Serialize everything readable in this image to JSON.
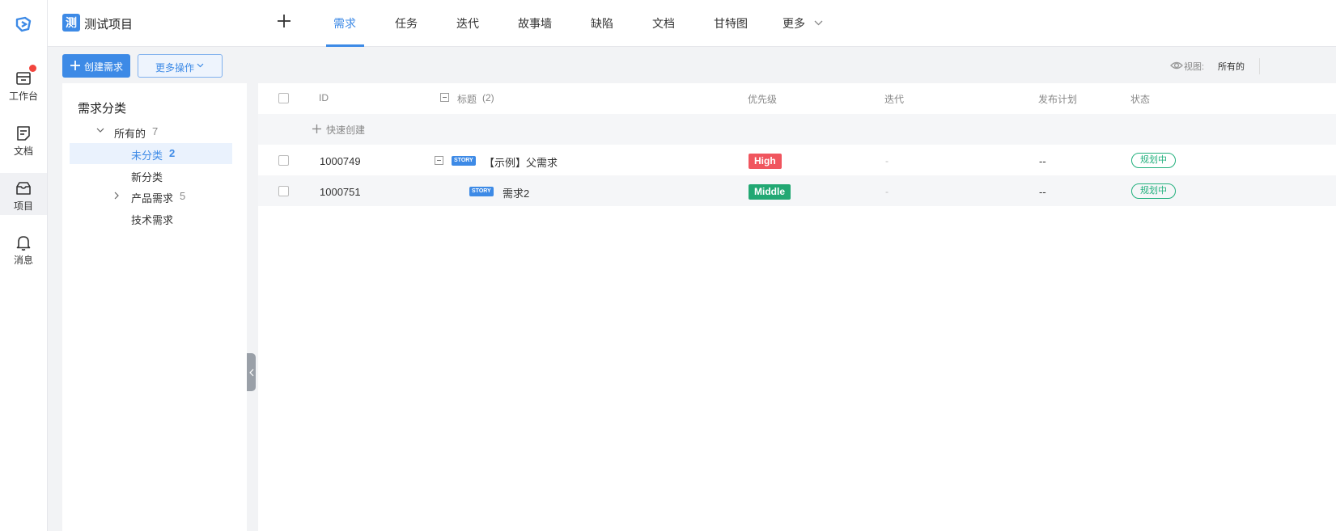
{
  "rail": {
    "items": [
      {
        "label": "工作台"
      },
      {
        "label": "文档"
      },
      {
        "label": "项目"
      },
      {
        "label": "消息"
      }
    ]
  },
  "project": {
    "badge": "测",
    "name": "测试项目"
  },
  "nav": {
    "tabs": [
      "需求",
      "任务",
      "迭代",
      "故事墙",
      "缺陷",
      "文档",
      "甘特图",
      "更多"
    ]
  },
  "toolbar": {
    "create_label": "创建需求",
    "more_label": "更多操作",
    "view_label": "视图:",
    "view_value": "所有的"
  },
  "categories": {
    "title": "需求分类",
    "items": [
      {
        "name": "所有的",
        "count": "7"
      },
      {
        "name": "未分类",
        "count": "2"
      },
      {
        "name": "新分类",
        "count": ""
      },
      {
        "name": "产品需求",
        "count": "5"
      },
      {
        "name": "技术需求",
        "count": ""
      }
    ]
  },
  "table": {
    "headers": {
      "id": "ID",
      "title": "标题",
      "title_count": "(2)",
      "priority": "优先级",
      "iteration": "迭代",
      "release": "发布计划",
      "status": "状态"
    },
    "quick_create": "快速创建",
    "rows": [
      {
        "id": "1000749",
        "tag": "STORY",
        "title": "【示例】父需求",
        "priority": "High",
        "iteration": "-",
        "release": "--",
        "status": "规划中"
      },
      {
        "id": "1000751",
        "tag": "STORY",
        "title": "需求2",
        "priority": "Middle",
        "iteration": "-",
        "release": "--",
        "status": "规划中"
      }
    ]
  },
  "colors": {
    "accent": "#3d8ae6",
    "high": "#f0555e",
    "middle": "#22a873",
    "status": "#22b07d",
    "notification_dot": "#f2453d"
  }
}
